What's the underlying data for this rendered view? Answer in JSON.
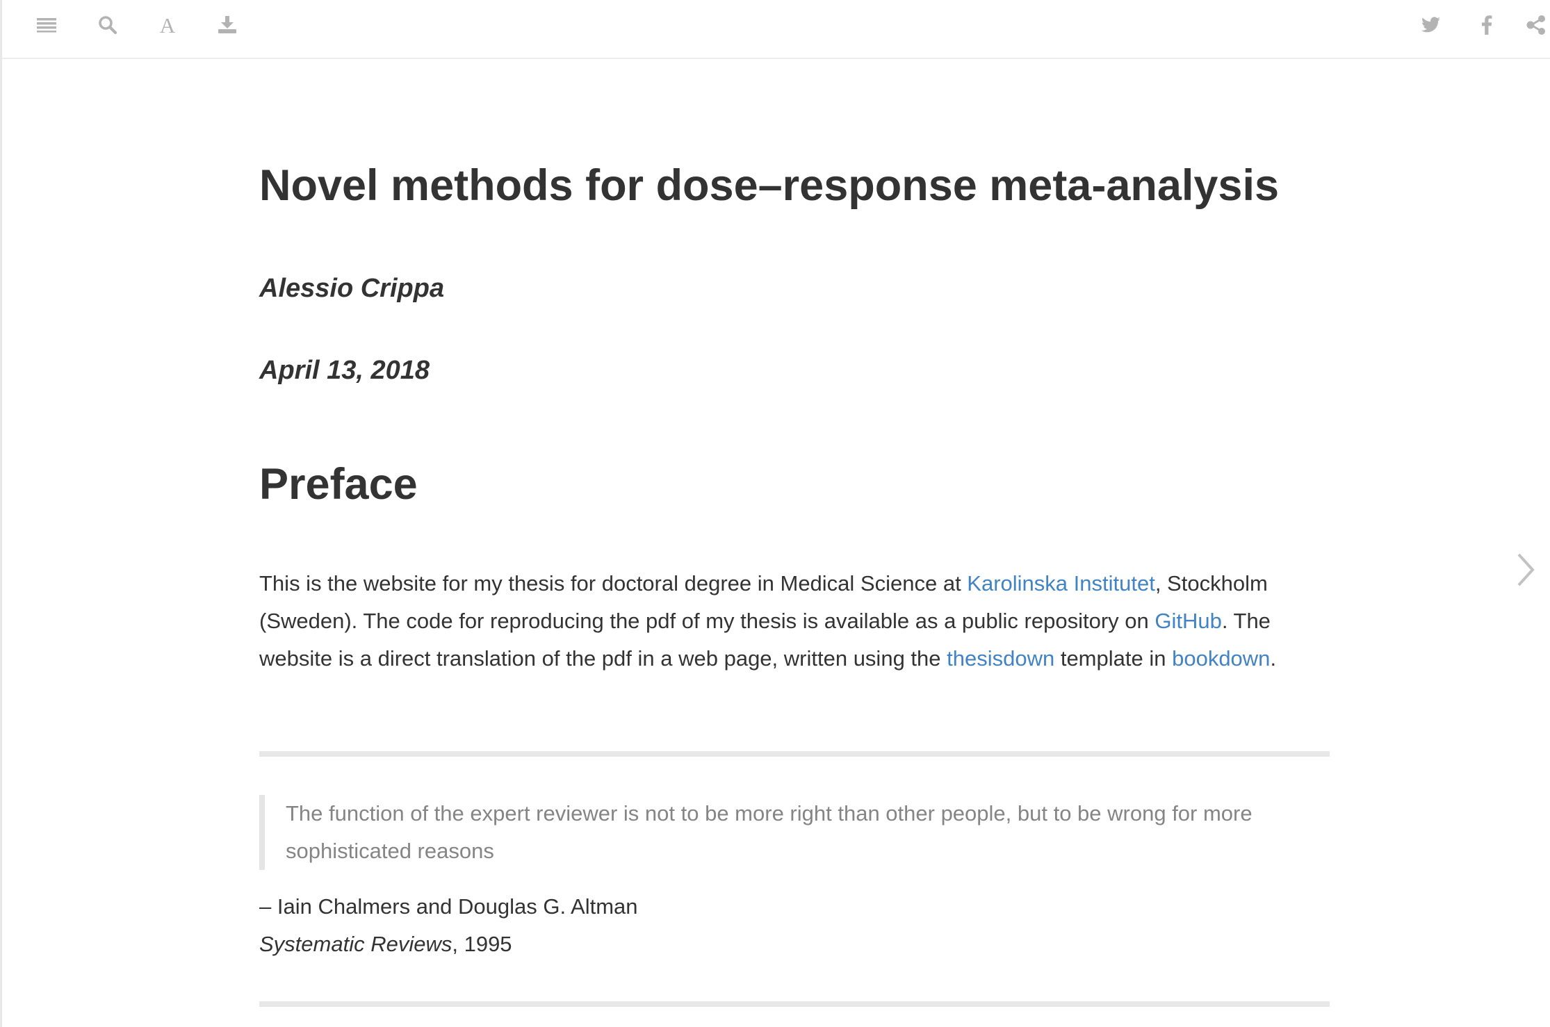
{
  "toolbar": {
    "left_icons": [
      "menu-icon",
      "search-icon",
      "font-settings-icon",
      "download-icon"
    ],
    "font_glyph": "A",
    "right_icons": [
      "twitter-icon",
      "facebook-icon",
      "share-icon"
    ],
    "icon_color": "#b3b3b3"
  },
  "document": {
    "title": "Novel methods for dose–response meta-analysis",
    "author": "Alessio Crippa",
    "date": "April 13, 2018"
  },
  "preface": {
    "heading": "Preface",
    "paragraph": {
      "part1": "This is the website for my thesis for doctoral degree in Medical Science at ",
      "link1": "Karolinska Institutet",
      "part2": ", Stockholm (Sweden). The code for reproducing the pdf of my thesis is available as a public repository on ",
      "link2": "GitHub",
      "part3": ". The website is a direct translation of the pdf in a web page, written using the ",
      "link3": "thesisdown",
      "part4": " template in ",
      "link4": "bookdown",
      "part5": "."
    },
    "quote": {
      "text": "The function of the expert reviewer is not to be more right than other people, but to be wrong for more sophisticated reasons",
      "attribution": "– Iain Chalmers and Douglas G. Altman",
      "source_title": "Systematic Reviews",
      "source_year": ", 1995"
    }
  },
  "navigation": {
    "next_icon": "chevron-right-icon"
  },
  "colors": {
    "link": "#4183c4",
    "text": "#333333",
    "quote_text": "#858585",
    "rule": "#e7e7e7"
  }
}
